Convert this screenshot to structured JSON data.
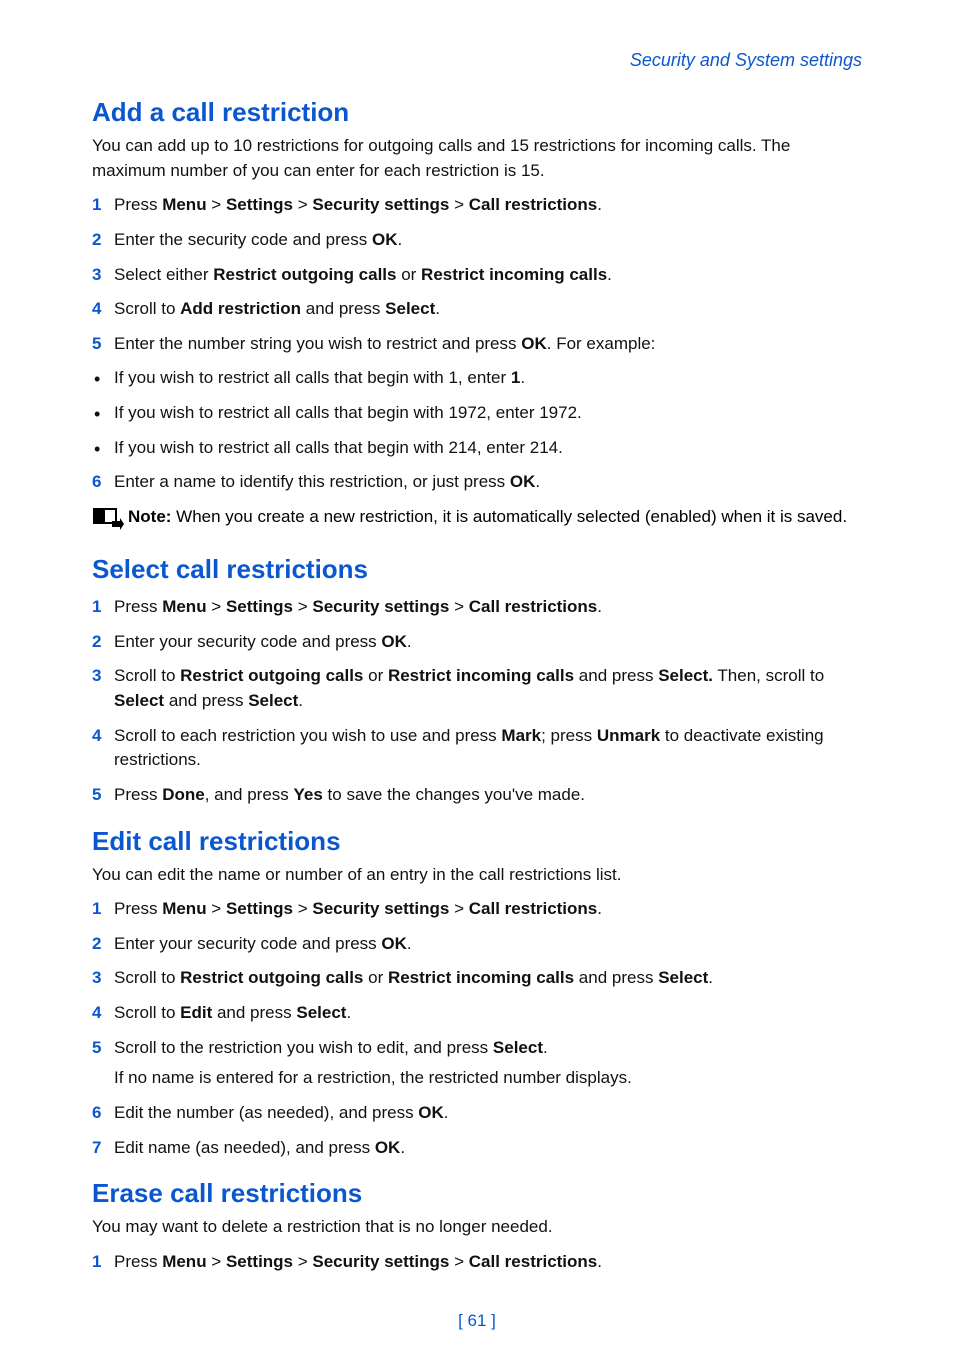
{
  "header": {
    "breadcrumb": "Security and System settings"
  },
  "sections": {
    "add": {
      "title": "Add a call restriction",
      "intro": "You can add up to 10 restrictions for outgoing calls and 15 restrictions for incoming calls. The maximum number of you can enter for each restriction is 15.",
      "steps": {
        "s1": {
          "num": "1",
          "pre": "Press ",
          "b1": "Menu",
          "sep1": " > ",
          "b2": "Settings",
          "sep2": " > ",
          "b3": "Security settings",
          "sep3": " > ",
          "b4": "Call restrictions",
          "post": "."
        },
        "s2": {
          "num": "2",
          "pre": "Enter the security code and press ",
          "b1": "OK",
          "post": "."
        },
        "s3": {
          "num": "3",
          "pre": "Select either ",
          "b1": "Restrict outgoing calls",
          "mid": " or ",
          "b2": "Restrict incoming calls",
          "post": "."
        },
        "s4": {
          "num": "4",
          "pre": "Scroll to ",
          "b1": "Add restriction",
          "mid": " and press ",
          "b2": "Select",
          "post": "."
        },
        "s5": {
          "num": "5",
          "pre": "Enter the number string you wish to restrict and press ",
          "b1": "OK",
          "post": ". For example:"
        },
        "s6": {
          "num": "6",
          "pre": "Enter a name to identify this restriction, or just press ",
          "b1": "OK",
          "post": "."
        }
      },
      "bullets": {
        "b1": {
          "pre": "If you wish to restrict all calls that begin with 1, enter ",
          "bold": "1",
          "post": "."
        },
        "b2": {
          "text": "If you wish to restrict all calls that begin with 1972, enter 1972."
        },
        "b3": {
          "text": "If you wish to restrict all calls that begin with 214, enter 214."
        }
      },
      "note": {
        "label": "Note:",
        "text": " When you create a new restriction, it is automatically selected (enabled) when it is saved."
      }
    },
    "select": {
      "title": "Select call restrictions",
      "steps": {
        "s1": {
          "num": "1",
          "pre": "Press ",
          "b1": "Menu",
          "sep1": " > ",
          "b2": "Settings",
          "sep2": " > ",
          "b3": "Security settings",
          "sep3": " > ",
          "b4": "Call restrictions",
          "post": "."
        },
        "s2": {
          "num": "2",
          "pre": "Enter your security code and press ",
          "b1": "OK",
          "post": "."
        },
        "s3": {
          "num": "3",
          "pre": "Scroll to ",
          "b1": "Restrict outgoing calls",
          "mid1": " or ",
          "b2": "Restrict incoming calls",
          "mid2": " and press ",
          "b3": "Select.",
          "mid3": " Then, scroll to ",
          "b4": "Select",
          "mid4": " and press ",
          "b5": "Select",
          "post": "."
        },
        "s4": {
          "num": "4",
          "pre": "Scroll to each restriction you wish to use and press ",
          "b1": "Mark",
          "mid": "; press ",
          "b2": "Unmark",
          "post": " to deactivate existing restrictions."
        },
        "s5": {
          "num": "5",
          "pre": "Press ",
          "b1": "Done",
          "mid": ", and press ",
          "b2": "Yes",
          "post": " to save the changes you've made."
        }
      }
    },
    "edit": {
      "title": "Edit call restrictions",
      "intro": "You can edit the name or number of an entry in the call restrictions list.",
      "steps": {
        "s1": {
          "num": "1",
          "pre": "Press ",
          "b1": "Menu",
          "sep1": " > ",
          "b2": "Settings",
          "sep2": " > ",
          "b3": "Security settings",
          "sep3": " > ",
          "b4": "Call restrictions",
          "post": "."
        },
        "s2": {
          "num": "2",
          "pre": "Enter your security code and press ",
          "b1": "OK",
          "post": "."
        },
        "s3": {
          "num": "3",
          "pre": "Scroll to ",
          "b1": "Restrict outgoing calls",
          "mid1": " or ",
          "b2": "Restrict incoming calls",
          "mid2": " and press ",
          "b3": "Select",
          "post": "."
        },
        "s4": {
          "num": "4",
          "pre": "Scroll to ",
          "b1": "Edit",
          "mid": " and press ",
          "b2": "Select",
          "post": "."
        },
        "s5": {
          "num": "5",
          "pre": "Scroll to the restriction you wish to edit, and press ",
          "b1": "Select",
          "post": ".",
          "sub": "If no name is entered for a restriction, the restricted number displays."
        },
        "s6": {
          "num": "6",
          "pre": "Edit the number (as needed), and press ",
          "b1": "OK",
          "post": "."
        },
        "s7": {
          "num": "7",
          "pre": "Edit name (as needed), and press ",
          "b1": "OK",
          "post": "."
        }
      }
    },
    "erase": {
      "title": "Erase call restrictions",
      "intro": "You may want to delete a restriction that is no longer needed.",
      "steps": {
        "s1": {
          "num": "1",
          "pre": "Press ",
          "b1": "Menu",
          "sep1": " > ",
          "b2": "Settings",
          "sep2": " > ",
          "b3": "Security settings",
          "sep3": " > ",
          "b4": "Call restrictions",
          "post": "."
        }
      }
    }
  },
  "footer": {
    "page": "[ 61 ]"
  }
}
